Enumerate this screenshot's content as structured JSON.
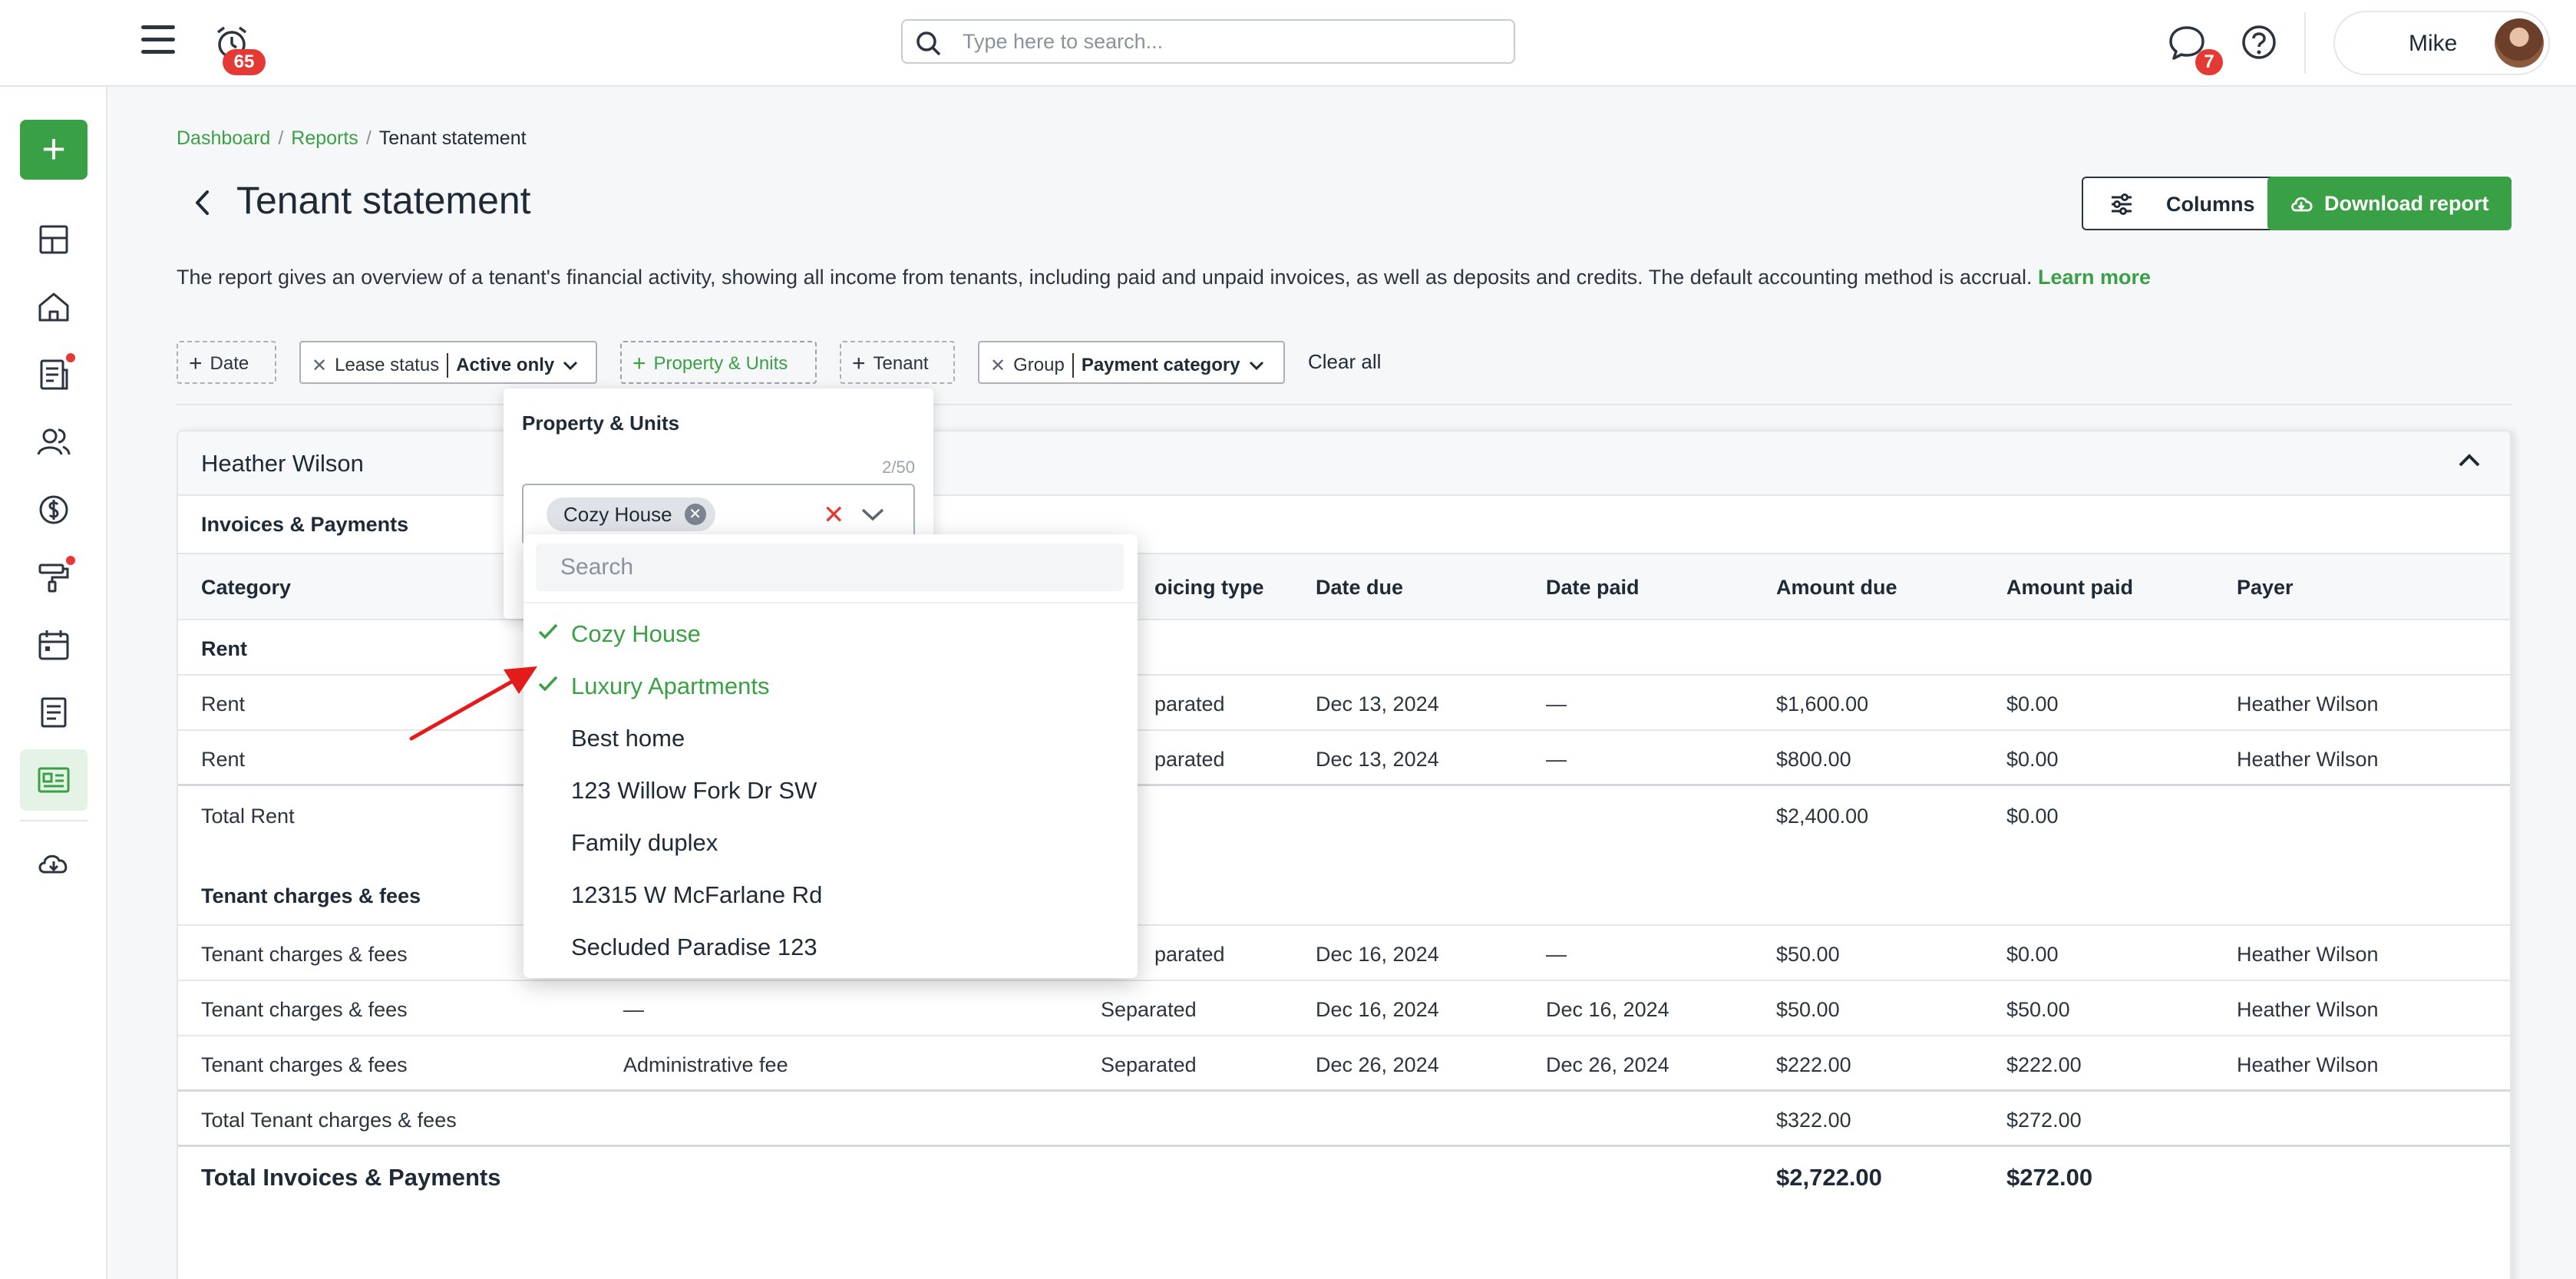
{
  "header": {
    "notifications_count": "65",
    "search_placeholder": "Type here to search...",
    "messages_count": "7",
    "user_name": "Mike"
  },
  "breadcrumb": {
    "items": [
      "Dashboard",
      "Reports",
      "Tenant statement"
    ],
    "separator": "/"
  },
  "page": {
    "title": "Tenant statement",
    "columns_button": "Columns",
    "download_button": "Download report",
    "description": "The report gives an overview of a tenant's financial activity, showing all income from tenants, including paid and unpaid invoices, as well as deposits and credits. The default accounting method is accrual.",
    "learn_more": "Learn more"
  },
  "filters": {
    "date": "Date",
    "lease_status_label": "Lease status",
    "lease_status_value": "Active only",
    "property_units": "Property & Units",
    "tenant": "Tenant",
    "group_label": "Group",
    "group_value": "Payment category",
    "clear_all": "Clear all"
  },
  "property_panel": {
    "title": "Property & Units",
    "count": "2/50",
    "selected_tag": "Cozy House",
    "search_placeholder": "Search",
    "options": [
      {
        "label": "Cozy House",
        "selected": true
      },
      {
        "label": "Luxury Apartments",
        "selected": true
      },
      {
        "label": "Best home",
        "selected": false
      },
      {
        "label": "123 Willow Fork Dr SW",
        "selected": false
      },
      {
        "label": "Family duplex",
        "selected": false
      },
      {
        "label": "12315 W McFarlane Rd",
        "selected": false
      },
      {
        "label": "Secluded Paradise 123",
        "selected": false
      }
    ]
  },
  "table": {
    "tenant_name": "Heather Wilson",
    "section": "Invoices & Payments",
    "columns": [
      "Category",
      "",
      "",
      "Invoicing type",
      "Date due",
      "Date paid",
      "Amount due",
      "Amount paid",
      "Payer"
    ],
    "visible_columns": {
      "category": "Category",
      "invoicing_type": "oicing type",
      "date_due": "Date due",
      "date_paid": "Date paid",
      "amount_due": "Amount due",
      "amount_paid": "Amount paid",
      "payer": "Payer"
    },
    "groups": {
      "rent": {
        "title": "Rent",
        "rows": [
          {
            "category": "Rent",
            "type": "parated",
            "due": "Dec 13, 2024",
            "paid": "—",
            "amount_due": "$1,600.00",
            "amount_paid": "$0.00",
            "payer": "Heather Wilson"
          },
          {
            "category": "Rent",
            "type": "parated",
            "due": "Dec 13, 2024",
            "paid": "—",
            "amount_due": "$800.00",
            "amount_paid": "$0.00",
            "payer": "Heather Wilson"
          }
        ],
        "total_label": "Total Rent",
        "total_due": "$2,400.00",
        "total_paid": "$0.00"
      },
      "fees": {
        "title": "Tenant charges & fees",
        "rows": [
          {
            "category": "Tenant charges & fees",
            "desc": "",
            "type": "parated",
            "due": "Dec 16, 2024",
            "paid": "—",
            "amount_due": "$50.00",
            "amount_paid": "$0.00",
            "payer": "Heather Wilson"
          },
          {
            "category": "Tenant charges & fees",
            "desc": "—",
            "type": "Separated",
            "due": "Dec 16, 2024",
            "paid": "Dec 16, 2024",
            "amount_due": "$50.00",
            "amount_paid": "$50.00",
            "payer": "Heather Wilson"
          },
          {
            "category": "Tenant charges & fees",
            "desc": "Administrative fee",
            "type": "Separated",
            "due": "Dec 26, 2024",
            "paid": "Dec 26, 2024",
            "amount_due": "$222.00",
            "amount_paid": "$222.00",
            "payer": "Heather Wilson"
          }
        ],
        "total_label": "Total Tenant charges & fees",
        "total_due": "$322.00",
        "total_paid": "$272.00"
      }
    },
    "grand_total_label": "Total Invoices & Payments",
    "grand_total_due": "$2,722.00",
    "grand_total_paid": "$272.00"
  },
  "icons": {
    "accent_green": "#3aa046",
    "alert_red": "#e53935"
  }
}
